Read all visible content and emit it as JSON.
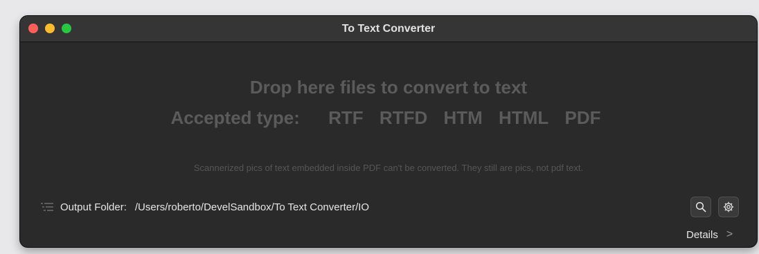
{
  "window": {
    "title": "To Text Converter"
  },
  "drop_area": {
    "heading": "Drop here files to convert to text",
    "accepted_label": "Accepted type:",
    "types": [
      "RTF",
      "RTFD",
      "HTM",
      "HTML",
      "PDF"
    ],
    "note": "Scannerized pics of text embedded inside PDF can't be converted. They still are pics, not pdf text."
  },
  "output": {
    "label": "Output Folder:",
    "path": "/Users/roberto/DevelSandbox/To Text Converter/IO"
  },
  "footer": {
    "details_label": "Details",
    "details_chevron": ">"
  },
  "icons": {
    "list": "list-lines-icon",
    "search": "magnifying-glass-icon",
    "settings": "gear-icon"
  },
  "colors": {
    "window_bg": "#2a2a2a",
    "titlebar_bg": "#353535",
    "close": "#fe5f57",
    "minimize": "#febc2e",
    "maximize": "#28c840",
    "hint_text": "#5b5b5b"
  }
}
